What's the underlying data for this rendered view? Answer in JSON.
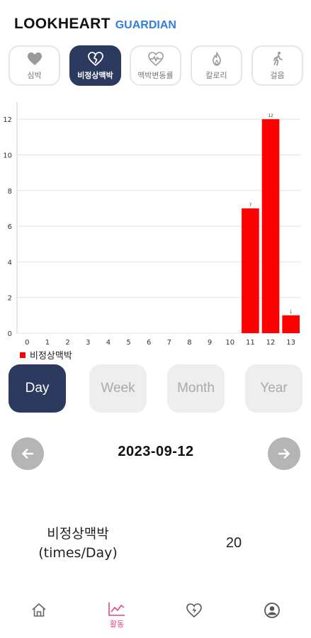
{
  "header": {
    "brand": "LOOKHEART",
    "brand_sub": "GUARDIAN"
  },
  "tabs": [
    {
      "label": "심박",
      "icon": "heart-icon",
      "active": false
    },
    {
      "label": "비정상맥박",
      "icon": "broken-heart-icon",
      "active": true
    },
    {
      "label": "맥박변동률",
      "icon": "heartbeat-icon",
      "active": false
    },
    {
      "label": "칼로리",
      "icon": "flame-icon",
      "active": false
    },
    {
      "label": "걸음",
      "icon": "walking-icon",
      "active": false
    }
  ],
  "chart_data": {
    "type": "bar",
    "categories": [
      "0",
      "1",
      "2",
      "3",
      "4",
      "5",
      "6",
      "7",
      "8",
      "9",
      "10",
      "11",
      "12",
      "13"
    ],
    "series": [
      {
        "name": "비정상맥박",
        "color": "#ff0000",
        "values": [
          0,
          0,
          0,
          0,
          0,
          0,
          0,
          0,
          0,
          0,
          0,
          7,
          12,
          1
        ]
      }
    ],
    "data_labels": {
      "11": "7",
      "12": "12",
      "13": "1"
    },
    "y_ticks": [
      "0",
      "2",
      "4",
      "6",
      "8",
      "10",
      "12"
    ],
    "ylim": [
      0,
      13
    ],
    "grid": true,
    "legend": "bottom-left"
  },
  "legend": {
    "label": "비정상맥박",
    "color": "#ff0000"
  },
  "period_buttons": [
    {
      "label": "Day",
      "active": true
    },
    {
      "label": "Week",
      "active": false
    },
    {
      "label": "Month",
      "active": false
    },
    {
      "label": "Year",
      "active": false
    }
  ],
  "date_nav": {
    "date": "2023-09-12",
    "prev_icon": "arrow-left-icon",
    "next_icon": "arrow-right-icon"
  },
  "summary": {
    "label_line1": "비정상맥박",
    "label_line2": "(times/Day)",
    "value": "20"
  },
  "bottom_nav": [
    {
      "label": "",
      "icon": "home-icon",
      "active": false
    },
    {
      "label": "활동",
      "icon": "activity-chart-icon",
      "active": true
    },
    {
      "label": "",
      "icon": "heart-bolt-icon",
      "active": false
    },
    {
      "label": "",
      "icon": "profile-icon",
      "active": false
    }
  ],
  "colors": {
    "accent": "#2b3a5e",
    "brand_blue": "#2f7fde",
    "bar": "#ff0000",
    "nav_active": "#e8457a"
  }
}
